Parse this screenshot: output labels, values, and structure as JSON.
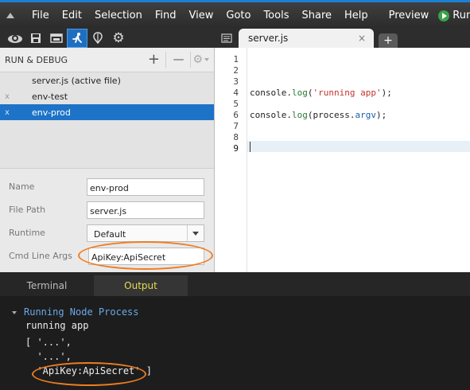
{
  "menu": {
    "items": [
      "File",
      "Edit",
      "Selection",
      "Find",
      "View",
      "Goto",
      "Tools",
      "Share",
      "Help"
    ],
    "preview_label": "Preview",
    "run_label": "Run"
  },
  "toolbar": {
    "icons": [
      "cloud-icon",
      "save-icon",
      "browser-icon",
      "run-debug-icon",
      "balloon-icon",
      "gear-icon"
    ]
  },
  "run_debug": {
    "title": "RUN & DEBUG",
    "add_label": "+",
    "remove_label": "—",
    "configurations": [
      {
        "mark": "",
        "label": "server.js (active file)"
      },
      {
        "mark": "x",
        "label": "env-test"
      },
      {
        "mark": "x",
        "label": "env-prod"
      }
    ],
    "selected_index": 2,
    "fields": {
      "name_label": "Name",
      "name_value": "env-prod",
      "path_label": "File Path",
      "path_value": "server.js",
      "runtime_label": "Runtime",
      "runtime_value": "Default",
      "args_label": "Cmd Line Args",
      "args_value": "ApiKey:ApiSecret"
    }
  },
  "editor": {
    "tab_title": "server.js",
    "tab_close": "×",
    "new_tab": "+",
    "line_numbers": [
      "1",
      "2",
      "3",
      "4",
      "5",
      "6",
      "7",
      "8",
      "9"
    ],
    "line4": {
      "obj": "console",
      "dot": ".",
      "fn": "log",
      "open": "(",
      "str": "'running app'",
      "close": ");"
    },
    "line6": {
      "obj": "console",
      "dot": ".",
      "fn": "log",
      "open": "(",
      "arg_obj": "process",
      "arg_dot": ".",
      "arg_prop": "argv",
      "close": ");"
    }
  },
  "bottom": {
    "tabs": [
      "Terminal",
      "Output"
    ],
    "active_tab": "Output",
    "process_title": "Running Node Process",
    "output_lines": [
      "running app",
      "[ '...',",
      "  '...',",
      "  'ApiKey:ApiSecret' ]"
    ]
  },
  "colors": {
    "accent": "#1d73c8",
    "highlight_ellipse": "#ef7d22",
    "run_green": "#3aa34a",
    "output_active_tab": "#e6db50"
  }
}
